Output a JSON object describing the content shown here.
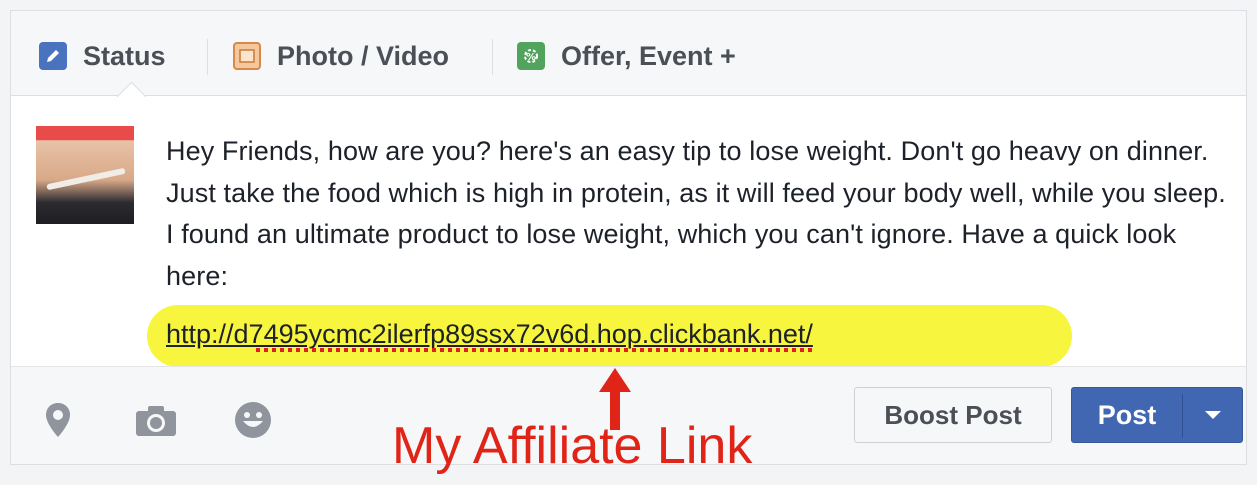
{
  "tabs": [
    {
      "label": "Status",
      "icon": "pencil-icon",
      "color": "#4267b2"
    },
    {
      "label": "Photo / Video",
      "icon": "photo-icon",
      "color": "#e2a271"
    },
    {
      "label": "Offer, Event +",
      "icon": "offer-icon",
      "color": "#48a05b"
    }
  ],
  "post": {
    "text": "Hey Friends, how are you? here's an easy tip to lose weight. Don't go heavy on dinner. Just take the food which is high in protein, as it will feed your body well, while you sleep. I found an ultimate product to lose weight, which you can't ignore. Have a quick look here:",
    "link": "http://d7495ycmc2ilerfp89ssx72v6d.hop.clickbank.net/",
    "highlight_color": "#f7f53d"
  },
  "toolbar": {
    "icons": [
      "location-icon",
      "camera-icon",
      "emoji-icon"
    ],
    "boost_label": "Boost Post",
    "post_label": "Post",
    "accent": "#4267b2"
  },
  "annotation": {
    "text": "My Affiliate Link",
    "color": "#e02418"
  }
}
